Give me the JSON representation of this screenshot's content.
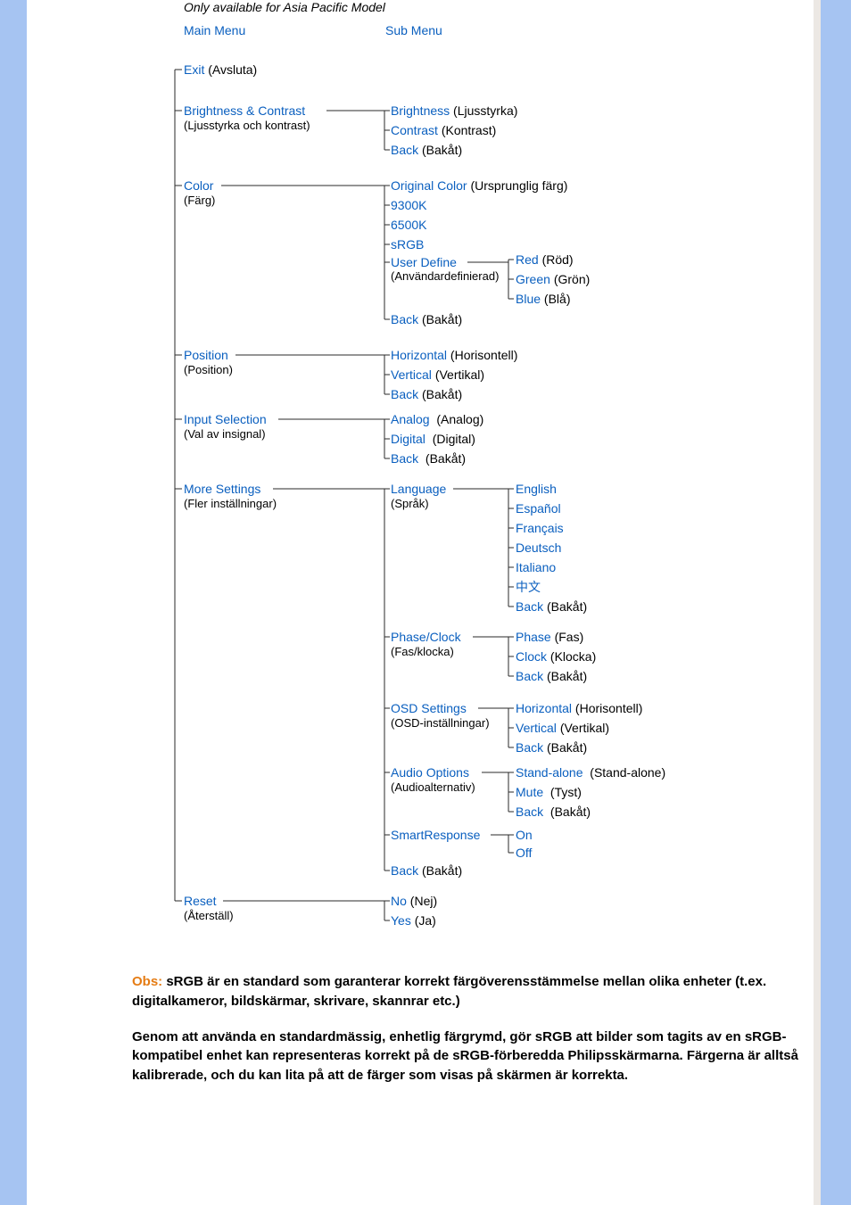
{
  "header": {
    "note": "Only available for Asia Pacific Model",
    "main": "Main Menu",
    "subm": "Sub Menu"
  },
  "menu": {
    "exit": "Exit",
    "exit_t": "(Avsluta)",
    "bc": "Brightness &  Contrast",
    "bc_t": "(Ljusstyrka och kontrast)",
    "bc_brightness": "Brightness",
    "bc_brightness_t": "(Ljusstyrka)",
    "bc_contrast": "Contrast",
    "bc_contrast_t": "(Kontrast)",
    "bc_back": "Back",
    "bc_back_t": "(Bakåt)",
    "color": "Color",
    "color_t": "(Färg)",
    "col_orig": "Original Color",
    "col_orig_t": "(Ursprunglig färg)",
    "col_9300": "9300K",
    "col_6500": "6500K",
    "col_srgb": "sRGB",
    "col_user": "User Define",
    "col_user_t": "(Användardefinierad)",
    "col_red": "Red",
    "col_red_t": "(Röd)",
    "col_green": "Green",
    "col_green_t": "(Grön)",
    "col_blue": "Blue",
    "col_blue_t": "(Blå)",
    "col_back": "Back",
    "col_back_t": "(Bakåt)",
    "pos": "Position",
    "pos_t": "(Position)",
    "pos_h": "Horizontal",
    "pos_h_t": "(Horisontell)",
    "pos_v": "Vertical",
    "pos_v_t": "(Vertikal)",
    "pos_back": "Back",
    "pos_back_t": "(Bakåt)",
    "inp": "Input Selection",
    "inp_t": "(Val av insignal)",
    "inp_a": "Analog",
    "inp_a_t": "(Analog)",
    "inp_d": "Digital",
    "inp_d_t": "(Digital)",
    "inp_back": "Back",
    "inp_back_t": "(Bakåt)",
    "more": "More Settings",
    "more_t": "(Fler inställningar)",
    "lang": "Language",
    "lang_t": "(Språk)",
    "lang_en": "English",
    "lang_es": "Español",
    "lang_fr": "Français",
    "lang_de": "Deutsch",
    "lang_it": "Italiano",
    "lang_zh": "中文",
    "lang_back": "Back",
    "lang_back_t": "(Bakåt)",
    "pc": "Phase/Clock",
    "pc_t": "(Fas/klocka)",
    "pc_phase": "Phase",
    "pc_phase_t": "(Fas)",
    "pc_clock": "Clock",
    "pc_clock_t": "(Klocka)",
    "pc_back": "Back",
    "pc_back_t": "(Bakåt)",
    "osd": "OSD Settings",
    "osd_t": "(OSD-inställningar)",
    "osd_h": "Horizontal",
    "osd_h_t": "(Horisontell)",
    "osd_v": "Vertical",
    "osd_v_t": "(Vertikal)",
    "osd_back": "Back",
    "osd_back_t": "(Bakåt)",
    "audio": "Audio Options",
    "audio_t": "(Audioalternativ)",
    "audio_sa": "Stand-alone",
    "audio_sa_t": "(Stand-alone)",
    "audio_mute": "Mute",
    "audio_mute_t": "(Tyst)",
    "audio_back": "Back",
    "audio_back_t": "(Bakåt)",
    "sr": "SmartResponse",
    "sr_on": "On",
    "sr_off": "Off",
    "more_back": "Back",
    "more_back_t": "(Bakåt)",
    "reset": "Reset",
    "reset_t": "(Återställ)",
    "reset_no": "No",
    "reset_no_t": "(Nej)",
    "reset_yes": "Yes",
    "reset_yes_t": "(Ja)"
  },
  "note": {
    "obs_label": "Obs:",
    "obs_text": " sRGB är en standard som garanterar korrekt färgöverensstämmelse mellan olika enheter (t.ex. digitalkameror, bildskärmar, skrivare, skannrar etc.)",
    "para2": "Genom att använda en standardmässig, enhetlig färgrymd, gör sRGB att bilder som tagits av en sRGB-kompatibel enhet kan representeras korrekt på de sRGB-förberedda Philipsskärmarna. Färgerna är alltså kalibrerade, och du kan lita på att de färger som visas på skärmen är korrekta."
  }
}
